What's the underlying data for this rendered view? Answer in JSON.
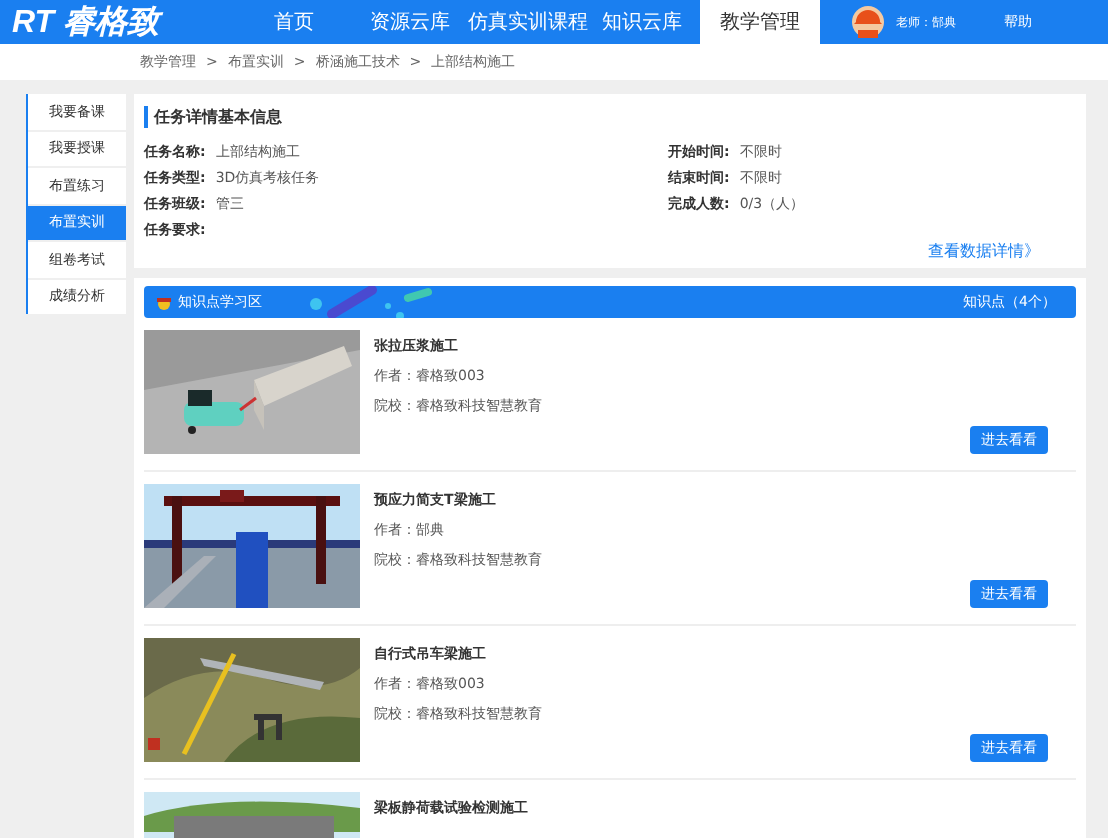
{
  "header": {
    "logo": "RT 睿格致",
    "nav": [
      {
        "label": "首页",
        "selected": false
      },
      {
        "label": "资源云库",
        "selected": false
      },
      {
        "label": "仿真实训课程",
        "selected": false
      },
      {
        "label": "知识云库",
        "selected": false
      },
      {
        "label": "教学管理",
        "selected": true
      }
    ],
    "user": "老师：郜典",
    "help": "帮助"
  },
  "breadcrumb": [
    "教学管理",
    "布置实训",
    "桥涵施工技术",
    "上部结构施工"
  ],
  "breadcrumb_separator": ">",
  "sidebar": {
    "items": [
      {
        "label": "我要备课",
        "selected": false
      },
      {
        "label": "我要授课",
        "selected": false
      },
      {
        "label": "布置练习",
        "selected": false
      },
      {
        "label": "布置实训",
        "selected": true
      },
      {
        "label": "组卷考试",
        "selected": false
      },
      {
        "label": "成绩分析",
        "selected": false
      }
    ]
  },
  "task": {
    "title": "任务详情基本信息",
    "left": [
      {
        "label": "任务名称:",
        "value": "上部结构施工"
      },
      {
        "label": "任务类型:",
        "value": "3D仿真考核任务"
      },
      {
        "label": "任务班级:",
        "value": "管三"
      },
      {
        "label": "任务要求:"
      }
    ],
    "right": [
      {
        "label": "开始时间:",
        "value": "不限时"
      },
      {
        "label": "结束时间:",
        "value": "不限时"
      },
      {
        "label": "完成人数:",
        "value": "0/3（人）"
      }
    ],
    "link": "查看数据详情》"
  },
  "knowledge": {
    "title": "知识点学习区",
    "count": "知识点（4个）",
    "items": [
      {
        "title": "张拉压浆施工",
        "author": "作者：睿格致003",
        "school": "院校：睿格致科技智慧教育",
        "button": "进去看看"
      },
      {
        "title": "预应力简支T梁施工",
        "author": "作者：郜典",
        "school": "院校：睿格致科技智慧教育",
        "button": "进去看看"
      },
      {
        "title": "自行式吊车梁施工",
        "author": "作者：睿格致003",
        "school": "院校：睿格致科技智慧教育",
        "button": "进去看看"
      },
      {
        "title": "梁板静荷载试验检测施工"
      }
    ]
  }
}
